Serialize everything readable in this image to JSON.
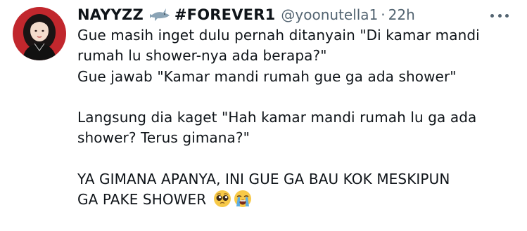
{
  "tweet": {
    "display_name": "NAYYZZ",
    "name_suffix": "#FOREVER1",
    "name_emoji_icon": "shark-icon",
    "handle": "@yoonutella1",
    "separator": "·",
    "time": "22h",
    "lines": [
      "Gue masih inget dulu pernah ditanyain \"Di kamar mandi",
      "rumah lu shower-nya ada berapa?\"",
      "Gue jawab \"Kamar mandi rumah gue ga ada shower\"",
      "",
      "Langsung dia kaget \"Hah kamar mandi rumah lu ga ada",
      "shower? Terus gimana?\"",
      "",
      "YA GIMANA APANYA, INI GUE GA BAU KOK MESKIPUN",
      "GA PAKE SHOWER"
    ],
    "end_emojis": [
      "pleading-face-emoji",
      "loudly-crying-face-emoji"
    ]
  },
  "colors": {
    "text": "#0f1419",
    "secondary": "#536471",
    "avatar_bg": "#c1272d"
  }
}
